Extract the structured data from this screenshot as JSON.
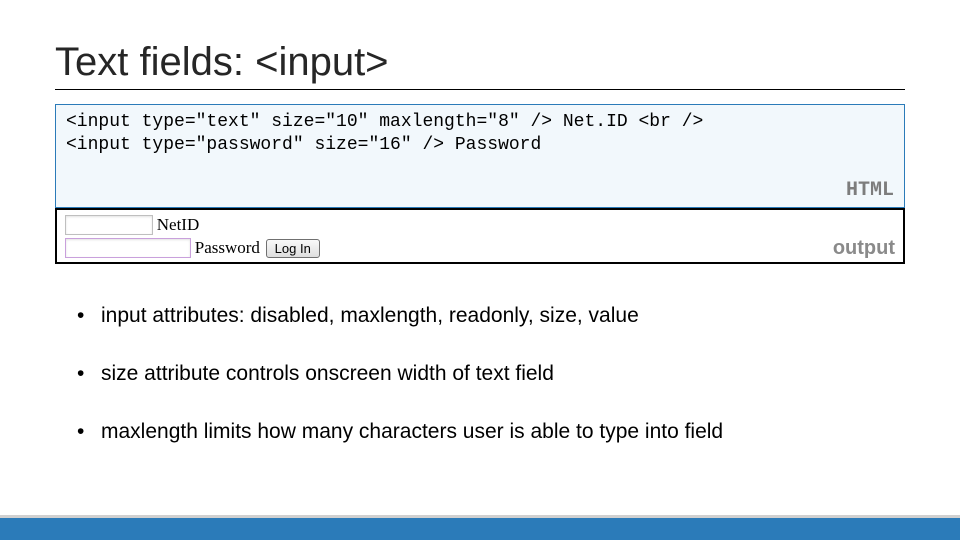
{
  "title": "Text fields: <input>",
  "code": {
    "line1": "<input type=\"text\" size=\"10\" maxlength=\"8\" /> Net.ID <br />",
    "line2": "<input type=\"password\" size=\"16\" /> Password",
    "label": "HTML"
  },
  "output": {
    "netid_label": "NetID",
    "password_label": "Password",
    "button_label": "Log In",
    "label": "output"
  },
  "bullets": [
    "input attributes: disabled, maxlength, readonly, size, value",
    "size attribute controls onscreen width of text field",
    "maxlength limits how many characters user is able to type into field"
  ]
}
